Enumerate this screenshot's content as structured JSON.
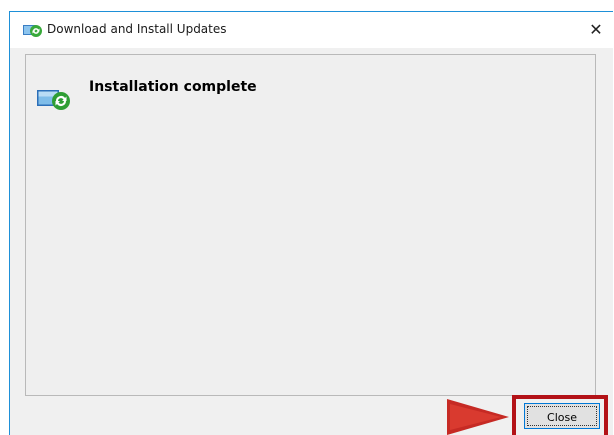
{
  "window": {
    "title": "Download and Install Updates",
    "close_glyph": "✕",
    "title_icon": "update-shield-icon"
  },
  "content": {
    "status_text": "Installation complete",
    "status_icon": "update-complete-icon"
  },
  "buttons": {
    "close_label": "Close"
  },
  "annotation": {
    "highlight_color": "#b31217",
    "arrow_color": "#c62a24"
  }
}
